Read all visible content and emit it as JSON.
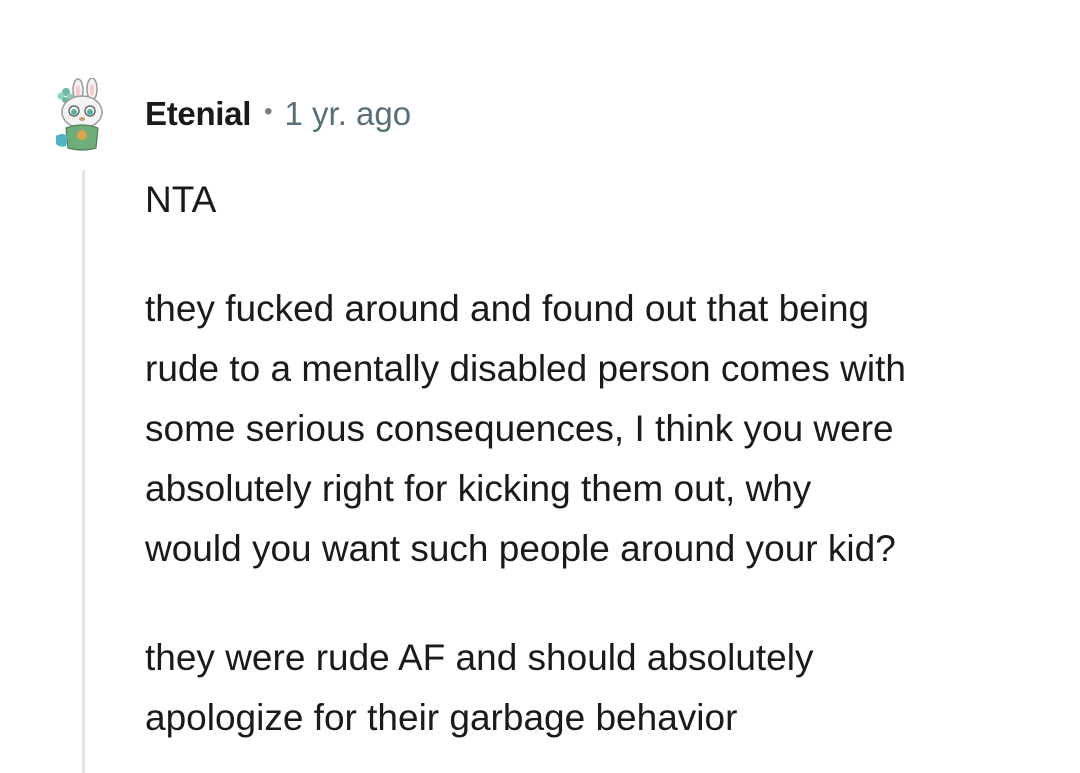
{
  "comment": {
    "author": "Etenial",
    "separator": "•",
    "age": "1 yr. ago",
    "avatar_icon": "bunny-avatar-icon",
    "paragraphs": [
      "NTA",
      "they fucked around and found out that being\nrude to a mentally disabled person comes with\nsome serious consequences, I think you were\nabsolutely right for kicking them out, why\nwould you want such people around your kid?",
      "they were rude AF and should absolutely\napologize for their garbage behavior"
    ]
  },
  "colors": {
    "text": "#1a1a1b",
    "meta": "#576f76",
    "thread_line": "#e5e5e5",
    "background": "#ffffff"
  }
}
